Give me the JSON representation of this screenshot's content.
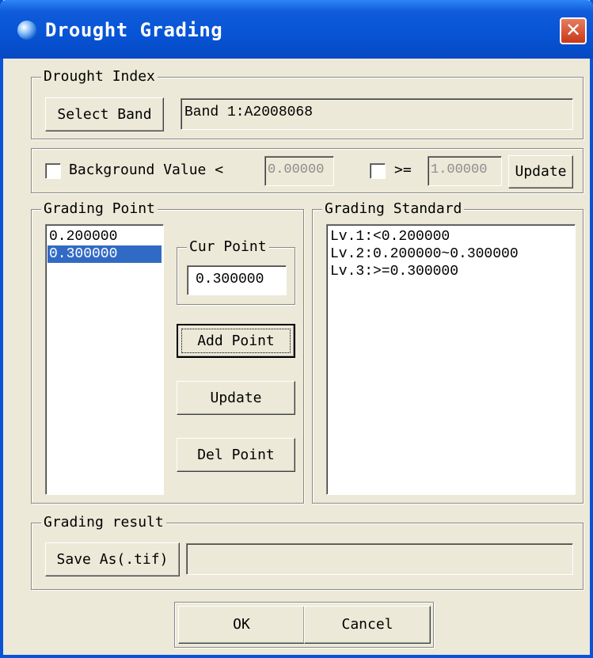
{
  "window": {
    "title": "Drought Grading",
    "close_icon": "close-icon",
    "app_icon": "globe-icon"
  },
  "drought_index": {
    "legend": "Drought Index",
    "select_band_label": "Select Band",
    "band_value": "Band 1:A2008068"
  },
  "background": {
    "checkbox1_checked": false,
    "label_less": "Background Value <",
    "less_value": "0.00000",
    "checkbox2_checked": false,
    "label_ge": ">=",
    "ge_value": "1.00000",
    "update_label": "Update"
  },
  "grading_point": {
    "legend": "Grading Point",
    "points": [
      "0.200000",
      "0.300000"
    ],
    "selected_index": 1,
    "cur_point_legend": "Cur Point",
    "cur_point_value": "0.300000",
    "add_point_label": "Add Point",
    "update_label": "Update",
    "del_point_label": "Del Point"
  },
  "grading_standard": {
    "legend": "Grading Standard",
    "lines": [
      "Lv.1:<0.200000",
      "Lv.2:0.200000~0.300000",
      "Lv.3:>=0.300000"
    ]
  },
  "grading_result": {
    "legend": "Grading result",
    "save_as_label": "Save As(.tif)",
    "path_value": ""
  },
  "footer": {
    "ok_label": "OK",
    "cancel_label": "Cancel"
  },
  "colors": {
    "title_bar": "#0754D5",
    "dialog_bg": "#ECE9D8",
    "selection": "#316AC5",
    "close_button": "#C9381A"
  }
}
